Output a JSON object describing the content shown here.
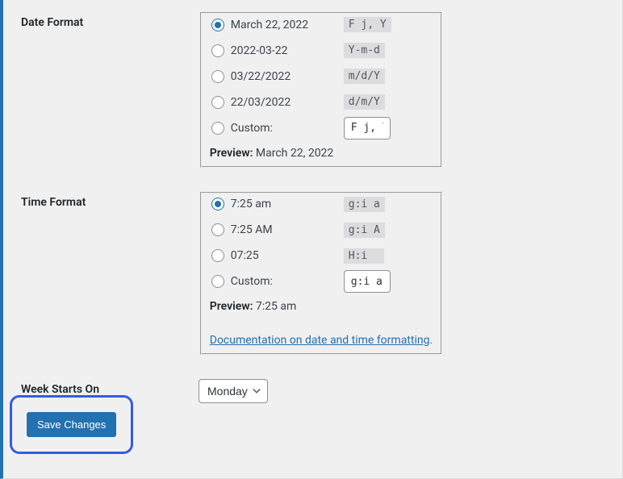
{
  "date_format": {
    "label": "Date Format",
    "options": [
      {
        "display": "March 22, 2022",
        "code": "F j, Y",
        "checked": true
      },
      {
        "display": "2022-03-22",
        "code": "Y-m-d",
        "checked": false
      },
      {
        "display": "03/22/2022",
        "code": "m/d/Y",
        "checked": false
      },
      {
        "display": "22/03/2022",
        "code": "d/m/Y",
        "checked": false
      }
    ],
    "custom_label": "Custom:",
    "custom_value": "F j, Y",
    "preview_label": "Preview:",
    "preview_value": "March 22, 2022"
  },
  "time_format": {
    "label": "Time Format",
    "options": [
      {
        "display": "7:25 am",
        "code": "g:i a",
        "checked": true
      },
      {
        "display": "7:25 AM",
        "code": "g:i A",
        "checked": false
      },
      {
        "display": "07:25",
        "code": "H:i",
        "checked": false
      }
    ],
    "custom_label": "Custom:",
    "custom_value": "g:i a",
    "preview_label": "Preview:",
    "preview_value": "7:25 am"
  },
  "docs_link": "Documentation on date and time formatting",
  "week": {
    "label": "Week Starts On",
    "value": "Monday"
  },
  "save_button": "Save Changes"
}
